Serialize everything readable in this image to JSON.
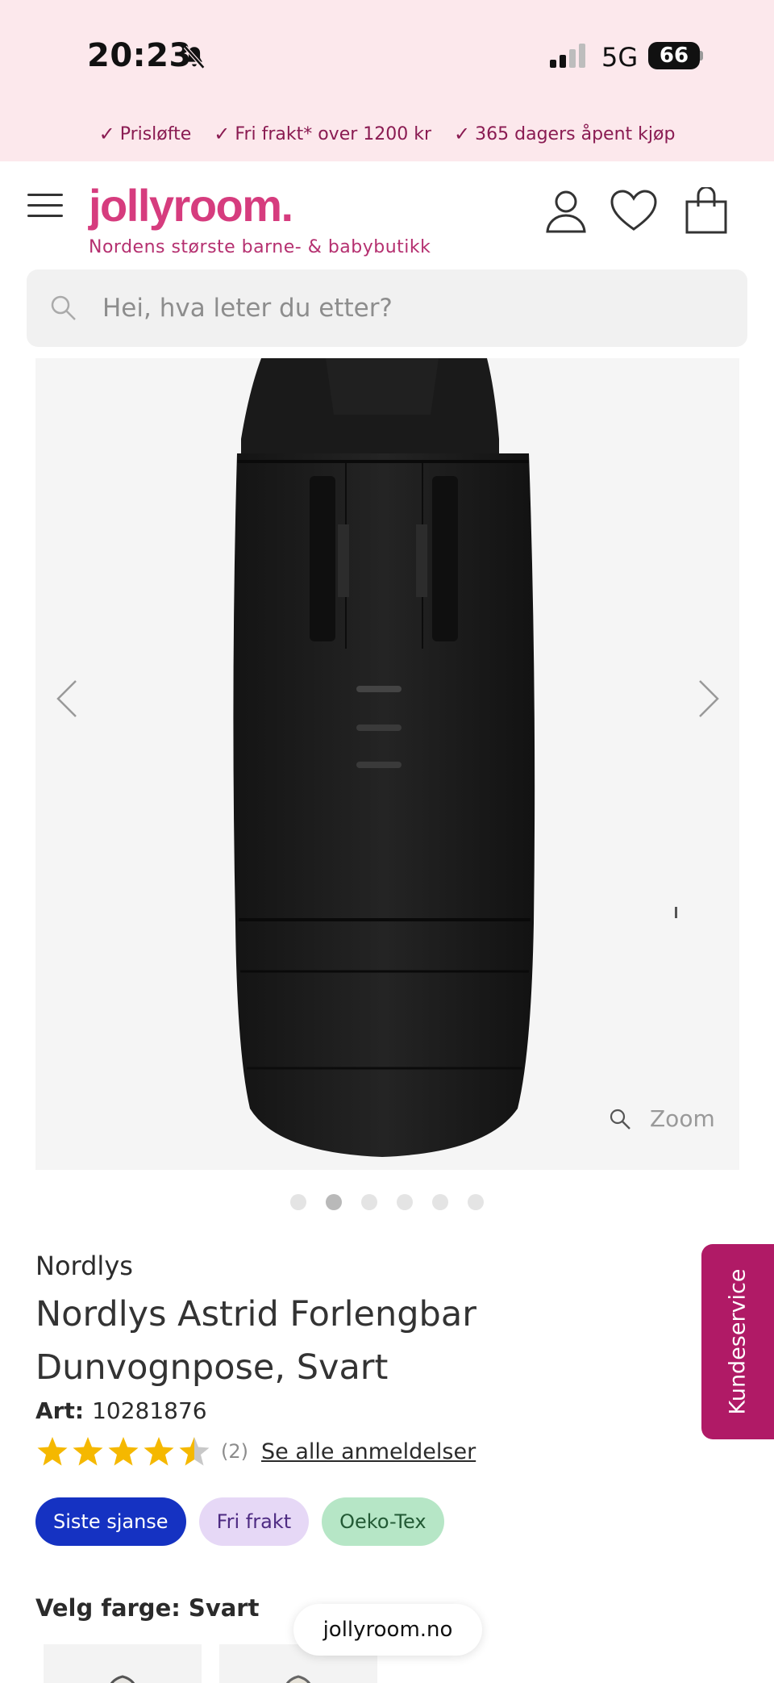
{
  "status_bar": {
    "time": "20:23",
    "network": "5G",
    "battery": "66"
  },
  "usp": [
    {
      "check": "✓",
      "text": "Prisløfte"
    },
    {
      "check": "✓",
      "text": "Fri frakt* over 1200 kr"
    },
    {
      "check": "✓",
      "text": "365 dagers åpent kjøp"
    }
  ],
  "header": {
    "logo": "jollyroom.",
    "tagline": "Nordens største barne- & babybutikk"
  },
  "search": {
    "placeholder": "Hei, hva leter du etter?"
  },
  "gallery": {
    "zoom_label": "Zoom",
    "slide_count": 6,
    "active_slide": 2
  },
  "product": {
    "brand": "Nordlys",
    "title": "Nordlys Astrid Forlengbar Dunvognpose, Svart",
    "art_label": "Art:",
    "art_number": "10281876",
    "rating": 4.5,
    "review_count": "(2)",
    "reviews_link": "Se alle anmeldelser",
    "badges": [
      "Siste sjanse",
      "Fri frakt",
      "Oeko-Tex"
    ],
    "color_label": "Velg farge: Svart"
  },
  "customer_service": "Kundeservice",
  "browser": {
    "url": "jollyroom.no"
  },
  "colors": {
    "brand_pink": "#d63c7e",
    "top_bar_bg": "#fce8ec",
    "service_tab": "#b01a66",
    "star": "#f5b800"
  }
}
